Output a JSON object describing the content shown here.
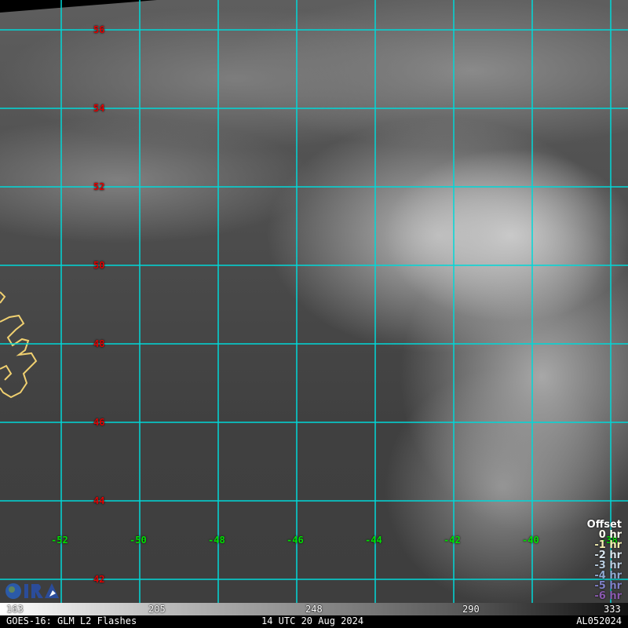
{
  "map": {
    "lat_labels": [
      "56",
      "54",
      "52",
      "50",
      "48",
      "46",
      "44",
      "42"
    ],
    "lon_labels": [
      "-52",
      "-50",
      "-48",
      "-46",
      "-44",
      "-42",
      "-40",
      "-38"
    ],
    "grid_color": "#00d8d8"
  },
  "legend": {
    "title": "Offset",
    "items": [
      {
        "label": "0 hr",
        "color": "#fffff0"
      },
      {
        "label": "-1 hr",
        "color": "#f4f0b0"
      },
      {
        "label": "-2 hr",
        "color": "#d8e4ec"
      },
      {
        "label": "-3 hr",
        "color": "#b8cce0"
      },
      {
        "label": "-4 hr",
        "color": "#90a8d0"
      },
      {
        "label": "-5 hr",
        "color": "#8080c8"
      },
      {
        "label": "-6 hr",
        "color": "#8a5ab0"
      }
    ]
  },
  "colorbar": {
    "ticks": [
      "163",
      "205",
      "248",
      "290",
      "333"
    ]
  },
  "footer": {
    "product": "GOES-16: GLM L2 Flashes",
    "time": "14 UTC 20 Aug 2024",
    "storm_id": "AL052024"
  },
  "logo": {
    "text": "CIRA"
  }
}
